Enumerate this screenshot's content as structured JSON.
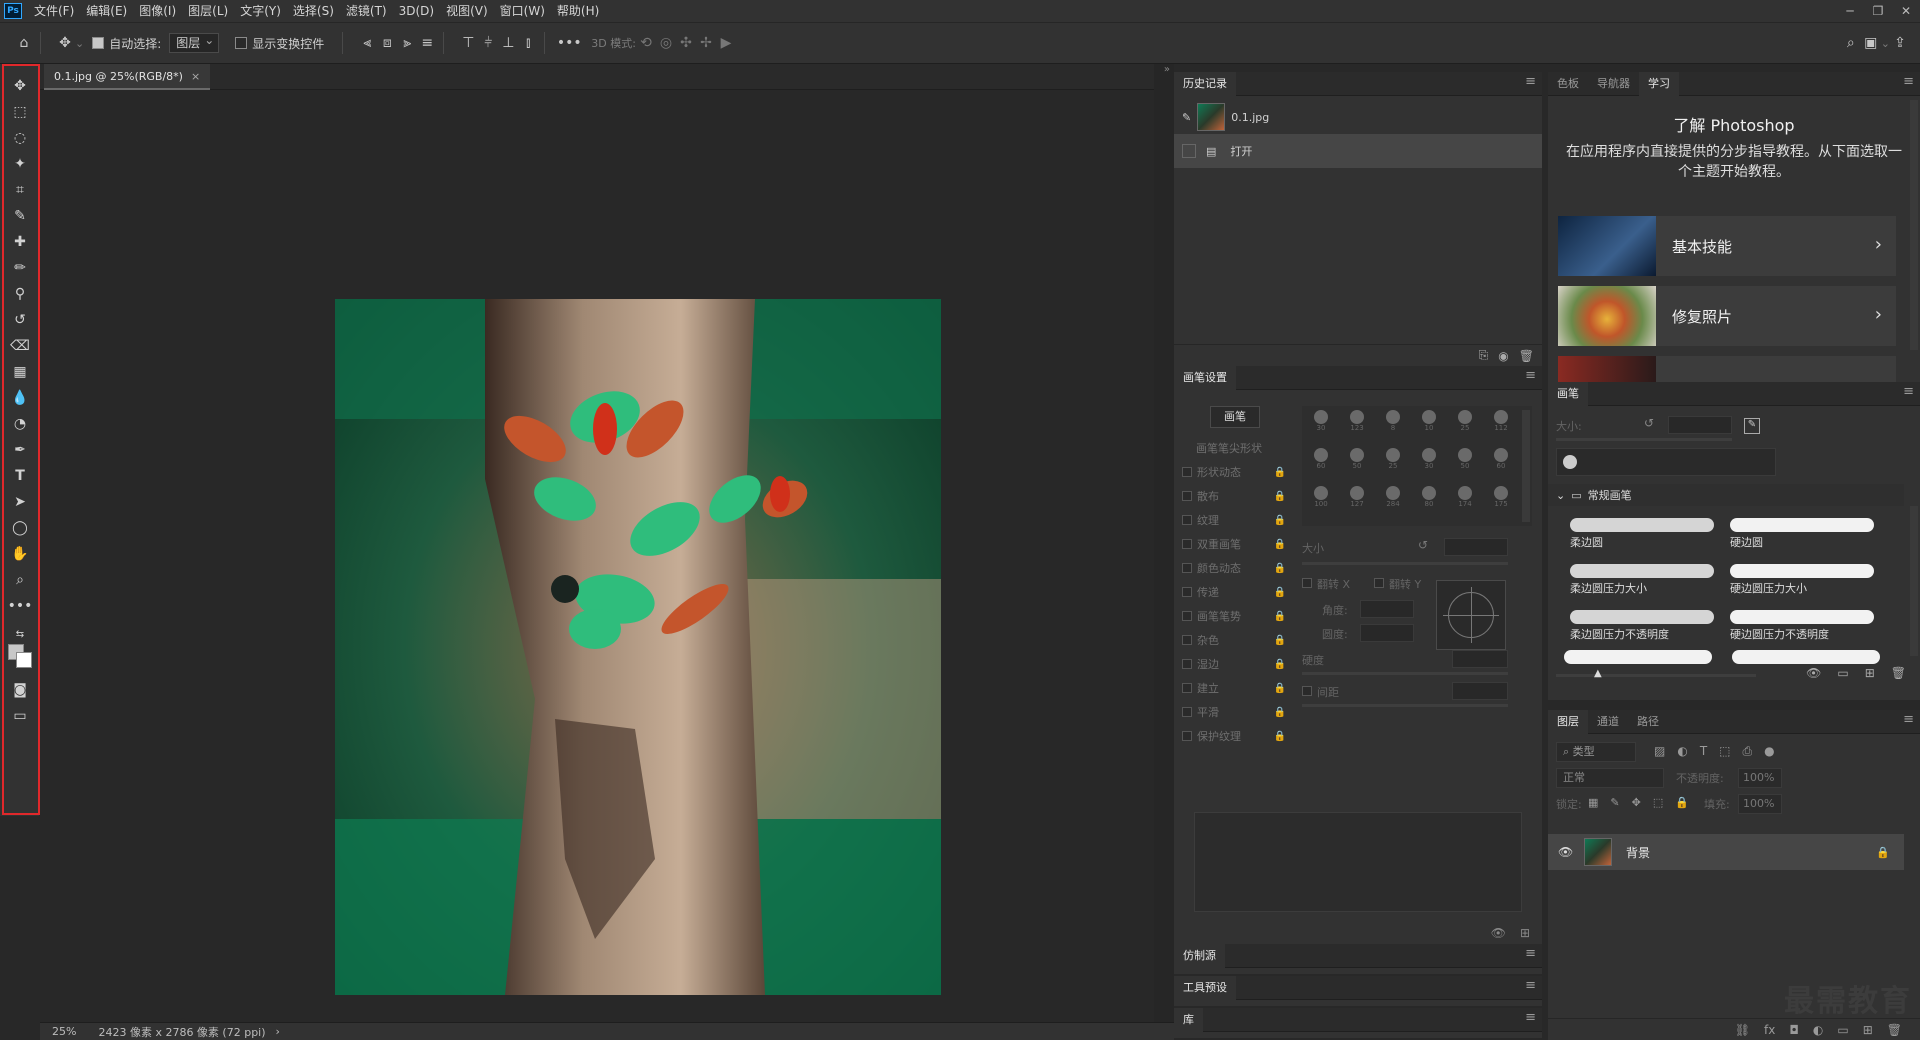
{
  "app": {
    "logo": "Ps"
  },
  "menu": [
    "文件(F)",
    "编辑(E)",
    "图像(I)",
    "图层(L)",
    "文字(Y)",
    "选择(S)",
    "滤镜(T)",
    "3D(D)",
    "视图(V)",
    "窗口(W)",
    "帮助(H)"
  ],
  "options": {
    "auto_select_label": "自动选择:",
    "auto_select_checked": true,
    "auto_select_target": "图层",
    "show_transform_label": "显示变换控件",
    "mode_3d_label": "3D 模式:"
  },
  "document": {
    "tab_title": "0.1.jpg @ 25%(RGB/8*)",
    "zoom": "25%",
    "info": "2423 像素 x 2786 像素 (72 ppi)"
  },
  "history": {
    "title": "历史记录",
    "snapshot": "0.1.jpg",
    "items": [
      "打开"
    ]
  },
  "brush_settings": {
    "title": "画笔设置",
    "brush_button": "画笔",
    "tip_shape": "画笔笔尖形状",
    "options": [
      "形状动态",
      "散布",
      "纹理",
      "双重画笔",
      "颜色动态",
      "传递",
      "画笔笔势",
      "杂色",
      "湿边",
      "建立",
      "平滑",
      "保护纹理"
    ],
    "tip_sizes": [
      "30",
      "123",
      "8",
      "10",
      "25",
      "112",
      "60",
      "50",
      "25",
      "30",
      "50",
      "60",
      "100",
      "127",
      "284",
      "80",
      "174",
      "175"
    ],
    "size_label": "大小",
    "flip_x": "翻转 X",
    "flip_y": "翻转 Y",
    "angle_label": "角度:",
    "roundness_label": "圆度:",
    "hardness_label": "硬度",
    "spacing_label": "间距"
  },
  "collapsed_panels": [
    "仿制源",
    "工具预设",
    "库"
  ],
  "learn": {
    "tabs": [
      "色板",
      "导航器",
      "学习"
    ],
    "active_tab": "学习",
    "title": "了解 Photoshop",
    "description": "在应用程序内直接提供的分步指导教程。从下面选取一个主题开始教程。",
    "cards": [
      "基本技能",
      "修复照片"
    ]
  },
  "brushes": {
    "title": "画笔",
    "size_label": "大小:",
    "group": "常规画笔",
    "items": [
      "柔边圆",
      "硬边圆",
      "柔边圆压力大小",
      "硬边圆压力大小",
      "柔边圆压力不透明度",
      "硬边圆压力不透明度"
    ]
  },
  "layers": {
    "tabs": [
      "图层",
      "通道",
      "路径"
    ],
    "active_tab": "图层",
    "filter_label": "类型",
    "blend_mode": "正常",
    "opacity_label": "不透明度:",
    "opacity": "100%",
    "lock_label": "锁定:",
    "fill_label": "填充:",
    "fill": "100%",
    "items": [
      {
        "name": "背景",
        "locked": true,
        "visible": true
      }
    ]
  },
  "watermark": "最需教育",
  "colors": {
    "accent_red": "#e0282b",
    "ps_blue": "#31a8ff"
  }
}
